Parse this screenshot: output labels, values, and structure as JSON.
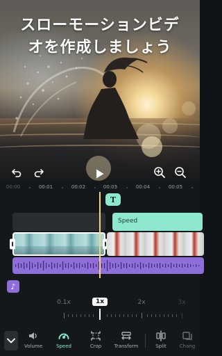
{
  "headline": {
    "line1": "スローモーションビデ",
    "line2": "オを作成しましょう"
  },
  "player": {
    "undo_icon": "undo-icon",
    "redo_icon": "redo-icon",
    "play_icon": "play-icon",
    "zoom_in_icon": "zoom-in-icon",
    "zoom_out_icon": "zoom-out-icon"
  },
  "ruler": {
    "ticks": [
      "00:00",
      "00:01",
      "00:02",
      "00:03",
      "00:04",
      "00:05"
    ]
  },
  "tracks": {
    "text_marker": "T",
    "speed_label": "Speed",
    "audio_marker": "♪"
  },
  "speed": {
    "options": [
      "0.1x",
      "1x",
      "2x",
      "3x"
    ],
    "selected": "1x"
  },
  "toolbar": {
    "collapse_icon": "chevron-down-icon",
    "items": [
      {
        "label": "Volume",
        "icon": "volume-icon"
      },
      {
        "label": "Speed",
        "icon": "speedometer-icon"
      },
      {
        "label": "Crop",
        "icon": "crop-icon"
      },
      {
        "label": "Transform",
        "icon": "transform-icon"
      },
      {
        "label": "Split",
        "icon": "split-icon"
      },
      {
        "label": "Chang",
        "icon": "change-icon"
      }
    ],
    "active": "Speed"
  },
  "colors": {
    "accent": "#7fe6cf",
    "speed_clip": "#8ee8cf",
    "audio_track": "#8e6fd8",
    "playhead": "#f5d67a",
    "background": "#15181b"
  }
}
